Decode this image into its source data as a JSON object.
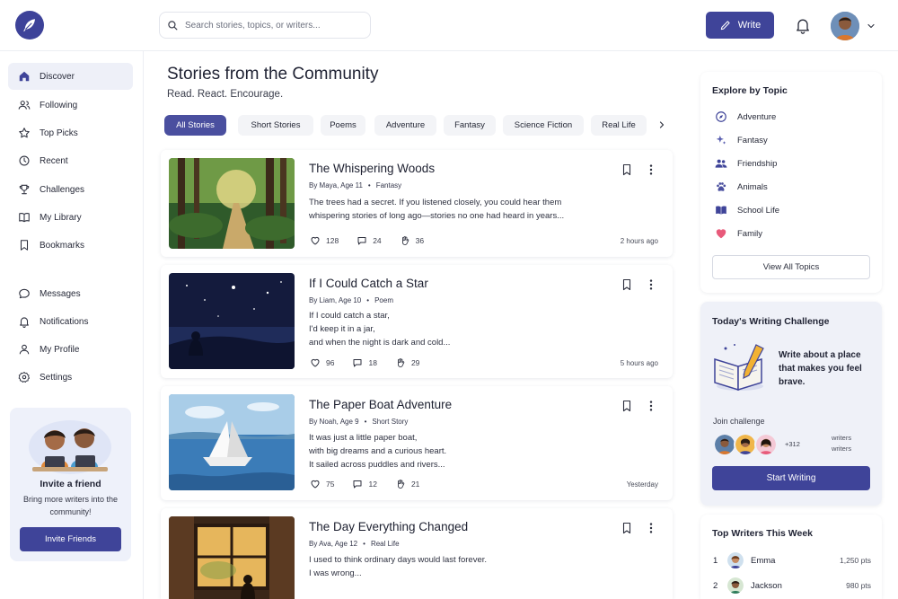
{
  "header": {
    "search_placeholder": "Search stories, topics, or writers...",
    "write_label": "Write"
  },
  "sidebar": {
    "items": [
      {
        "label": "Discover"
      },
      {
        "label": "Following"
      },
      {
        "label": "Top Picks"
      },
      {
        "label": "Recent"
      },
      {
        "label": "Challenges"
      },
      {
        "label": "My Library"
      },
      {
        "label": "Bookmarks"
      },
      {
        "label": "Messages"
      },
      {
        "label": "Notifications"
      },
      {
        "label": "My Profile"
      },
      {
        "label": "Settings"
      }
    ],
    "invite": {
      "title": "Invite a friend",
      "text": "Bring more writers into the community!",
      "button": "Invite Friends"
    }
  },
  "main": {
    "title": "Stories from the Community",
    "subtitle": "Read. React. Encourage.",
    "tabs": [
      {
        "label": "All Stories"
      },
      {
        "label": "Short Stories"
      },
      {
        "label": "Poems"
      },
      {
        "label": "Adventure"
      },
      {
        "label": "Fantasy"
      },
      {
        "label": "Science Fiction"
      },
      {
        "label": "Real Life"
      }
    ],
    "stories": [
      {
        "title": "The Whispering Woods",
        "author": "By Maya, Age 11",
        "genre": "Fantasy",
        "excerpt": [
          "The trees had a secret. If you listened closely, you could hear them",
          "whispering stories of long ago—stories no one had heard in years..."
        ],
        "likes": "128",
        "comments": "24",
        "claps": "36",
        "time": "2 hours ago"
      },
      {
        "title": "If I Could Catch a Star",
        "author": "By Liam, Age 10",
        "genre": "Poem",
        "excerpt": [
          "If I could catch a star,",
          "I'd keep it in a jar,",
          "and when the night is dark and cold..."
        ],
        "likes": "96",
        "comments": "18",
        "claps": "29",
        "time": "5 hours ago"
      },
      {
        "title": "The Paper Boat Adventure",
        "author": "By Noah, Age 9",
        "genre": "Short Story",
        "excerpt": [
          "It was just a little paper boat,",
          "with big dreams and a curious heart.",
          "It sailed across puddles and rivers..."
        ],
        "likes": "75",
        "comments": "12",
        "claps": "21",
        "time": "Yesterday"
      },
      {
        "title": "The Day Everything Changed",
        "author": "By Ava, Age 12",
        "genre": "Real Life",
        "excerpt": [
          "I used to think ordinary days would last forever.",
          "I was wrong..."
        ],
        "likes": "",
        "comments": "",
        "claps": "",
        "time": ""
      }
    ]
  },
  "right": {
    "topics_title": "Explore by Topic",
    "topics": [
      {
        "label": "Adventure",
        "color": "#3f4499"
      },
      {
        "label": "Fantasy",
        "color": "#5a5fb0"
      },
      {
        "label": "Friendship",
        "color": "#3f4499"
      },
      {
        "label": "Animals",
        "color": "#4b509f"
      },
      {
        "label": "School Life",
        "color": "#3f4499"
      },
      {
        "label": "Family",
        "color": "#e85a7a"
      }
    ],
    "view_all": "View All Topics",
    "challenge": {
      "title": "Today's Writing Challenge",
      "prompt": "Write about a place that makes you feel brave.",
      "join": "Join challenge",
      "count": "+312",
      "writers_label": "writers",
      "button": "Start Writing"
    },
    "top_writers": {
      "title": "Top Writers This Week",
      "rows": [
        {
          "rank": "1",
          "name": "Emma",
          "pts": "1,250 pts"
        },
        {
          "rank": "2",
          "name": "Jackson",
          "pts": "980 pts"
        }
      ]
    }
  },
  "colors": {
    "accent": "#3f4499",
    "active_nav_bg": "#eef0f8"
  }
}
